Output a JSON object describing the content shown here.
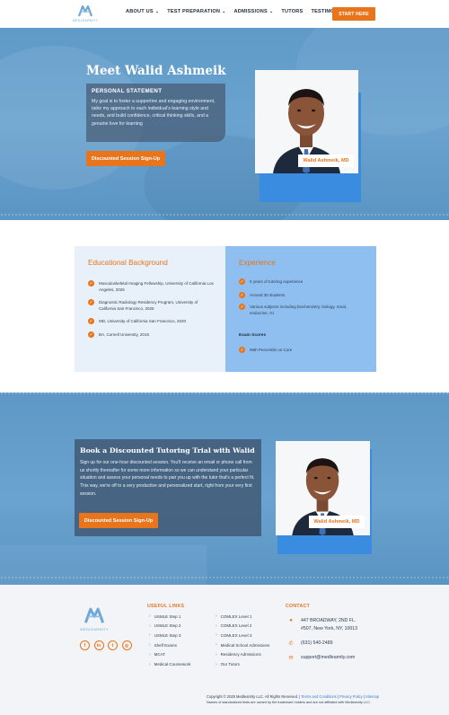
{
  "brand": {
    "logo_text": "MEDLEARNITY",
    "accent": "#e8741c",
    "blue": "#6aa3cf"
  },
  "nav": {
    "items": [
      {
        "label": "ABOUT US",
        "dropdown": true
      },
      {
        "label": "TEST PREPARATION",
        "dropdown": true
      },
      {
        "label": "ADMISSIONS",
        "dropdown": true
      },
      {
        "label": "TUTORS",
        "dropdown": false
      },
      {
        "label": "TESTIMONIALS",
        "dropdown": false
      },
      {
        "label": "FAQ",
        "dropdown": false
      }
    ],
    "cta": "START HERE"
  },
  "hero": {
    "title": "Meet Walid Ashmeik",
    "statement_heading": "PERSONAL STATEMENT",
    "statement_text": "My goal is to foster a supportive and engaging environment, tailor my approach to each individual's learning style and needs, and build confidence, critical thinking skills, and a genuine love for learning",
    "button": "Discounted Session Sign-Up",
    "name_tag": "Walid Ashmeik, MD"
  },
  "education": {
    "title": "Educational Background",
    "items": [
      "Musculoskeletal Imaging Fellowship, University of California Los Angeles, 2026",
      "Diagnostic Radiology Residency Program, University of California San Francisco, 2025",
      "MD, University of California San Francisco, 2020",
      "BA, Cornell University, 2015"
    ]
  },
  "experience": {
    "title": "Experience",
    "items": [
      "5 years of tutoring experience",
      "Around 30 students",
      "Various subjects including biochemistry, biology, renal, endocrine, GI"
    ],
    "exam_heading": "Exam Scores",
    "exam_items": [
      "95th Percentile on Core"
    ]
  },
  "trial": {
    "title": "Book a Discounted Tutoring Trial with Walid",
    "text": "Sign up for our one-hour discounted session. You'll receive an email or phone call from us shortly thereafter for some more information so we can understand your particular situation and assess your personal needs to pair you up with the tutor that's a perfect fit. This way, we're off to a very productive and personalized start, right from your very first session.",
    "button": "Discounted Session Sign-Up",
    "name_tag": "Walid Ashmeik, MD"
  },
  "footer": {
    "logo_text": "MEDLEARNITY",
    "useful_links_title": "USEFUL LINKS",
    "links_col1": [
      "USMLE Step 1",
      "USMLE Step 2",
      "USMLE Step 3",
      "Shelf Exams",
      "MCAT",
      "Medical Coursework"
    ],
    "links_col2": [
      "COMLEX Level 1",
      "COMLEX Level 2",
      "COMLEX Level 3",
      "Medical School Admissions",
      "Residency Admissions",
      "Our Tutors"
    ],
    "contact_title": "CONTACT",
    "address_line1": "447 BROADWAY, 2ND FL.",
    "address_line2": "#507, New York, NY, 10013",
    "phone": "(631) 540-2489",
    "email": "support@medlearnity.com",
    "social": [
      {
        "icon": "facebook-icon",
        "glyph": "f"
      },
      {
        "icon": "linkedin-icon",
        "glyph": "in"
      },
      {
        "icon": "twitter-icon",
        "glyph": "t"
      },
      {
        "icon": "instagram-icon",
        "glyph": "◎"
      }
    ],
    "copyright": "Copyright © 2025 Medlearnity LLC. All Rights Reserved.",
    "sep1": " | ",
    "terms": "Terms and Conditions",
    "sep2": " | ",
    "privacy": "Privacy Policy",
    "sep3": " | ",
    "sitemap": "Sitemap",
    "disclaimer": "Names of standardized tests are owned by the trademark holders and are not affiliated with Medlearnity LLC."
  }
}
